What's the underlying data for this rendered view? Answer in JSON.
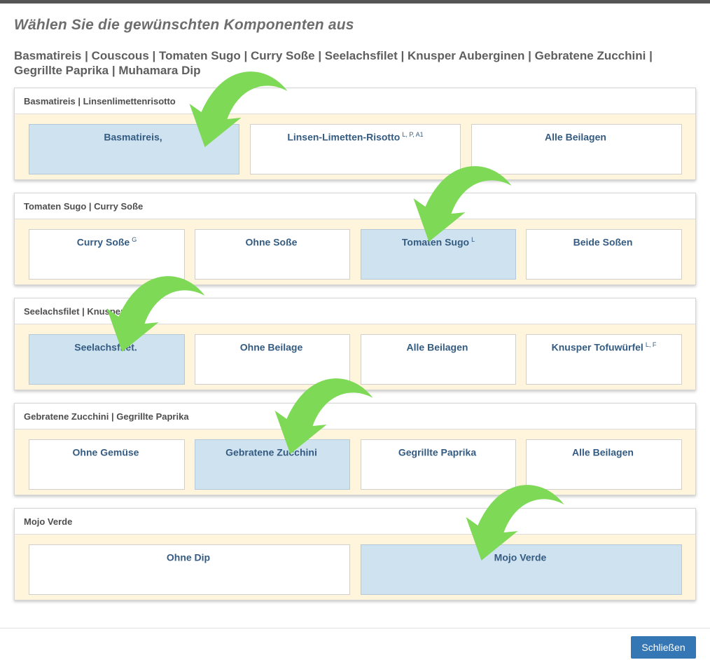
{
  "dialog": {
    "title": "Wählen Sie die gewünschten Komponenten aus",
    "summary": "Basmatireis | Couscous | Tomaten Sugo | Curry Soße | Seelachsfilet | Knusper Auberginen | Gebratene Zucchini | Gegrillte Paprika | Muhamara Dip",
    "close_label": "Schließen"
  },
  "groups": [
    {
      "header": "Basmatireis | Linsenlimettenrisotto",
      "options": [
        {
          "label": "Basmatireis,",
          "sup": "",
          "selected": true
        },
        {
          "label": "Linsen-Limetten-Risotto",
          "sup": "L, P, A1",
          "selected": false
        },
        {
          "label": "Alle Beilagen",
          "sup": "",
          "selected": false
        }
      ]
    },
    {
      "header": "Tomaten Sugo | Curry Soße",
      "options": [
        {
          "label": "Curry Soße",
          "sup": "G",
          "selected": false
        },
        {
          "label": "Ohne Soße",
          "sup": "",
          "selected": false
        },
        {
          "label": "Tomaten Sugo",
          "sup": "L",
          "selected": true
        },
        {
          "label": "Beide Soßen",
          "sup": "",
          "selected": false
        }
      ]
    },
    {
      "header": "Seelachsfilet | Knusper Tofu",
      "options": [
        {
          "label": "Seelachsfilet.",
          "sup": "",
          "selected": true
        },
        {
          "label": "Ohne Beilage",
          "sup": "",
          "selected": false
        },
        {
          "label": "Alle Beilagen",
          "sup": "",
          "selected": false
        },
        {
          "label": "Knusper Tofuwürfel",
          "sup": "L, F",
          "selected": false
        }
      ]
    },
    {
      "header": "Gebratene Zucchini | Gegrillte Paprika",
      "options": [
        {
          "label": "Ohne Gemüse",
          "sup": "",
          "selected": false
        },
        {
          "label": "Gebratene Zucchini",
          "sup": "",
          "selected": true
        },
        {
          "label": "Gegrillte Paprika",
          "sup": "",
          "selected": false
        },
        {
          "label": "Alle Beilagen",
          "sup": "",
          "selected": false
        }
      ]
    },
    {
      "header": "Mojo Verde",
      "options": [
        {
          "label": "Ohne Dip",
          "sup": "",
          "selected": false
        },
        {
          "label": "Mojo Verde",
          "sup": "",
          "selected": true
        }
      ]
    }
  ],
  "colors": {
    "selected_bg": "#cfe2ef",
    "group_bg": "#fff4dc",
    "option_text": "#345b82",
    "button_bg": "#3477b4",
    "arrow_green": "#7ed957"
  },
  "annotations": {
    "arrow_icon": "curved-arrow-icon"
  }
}
